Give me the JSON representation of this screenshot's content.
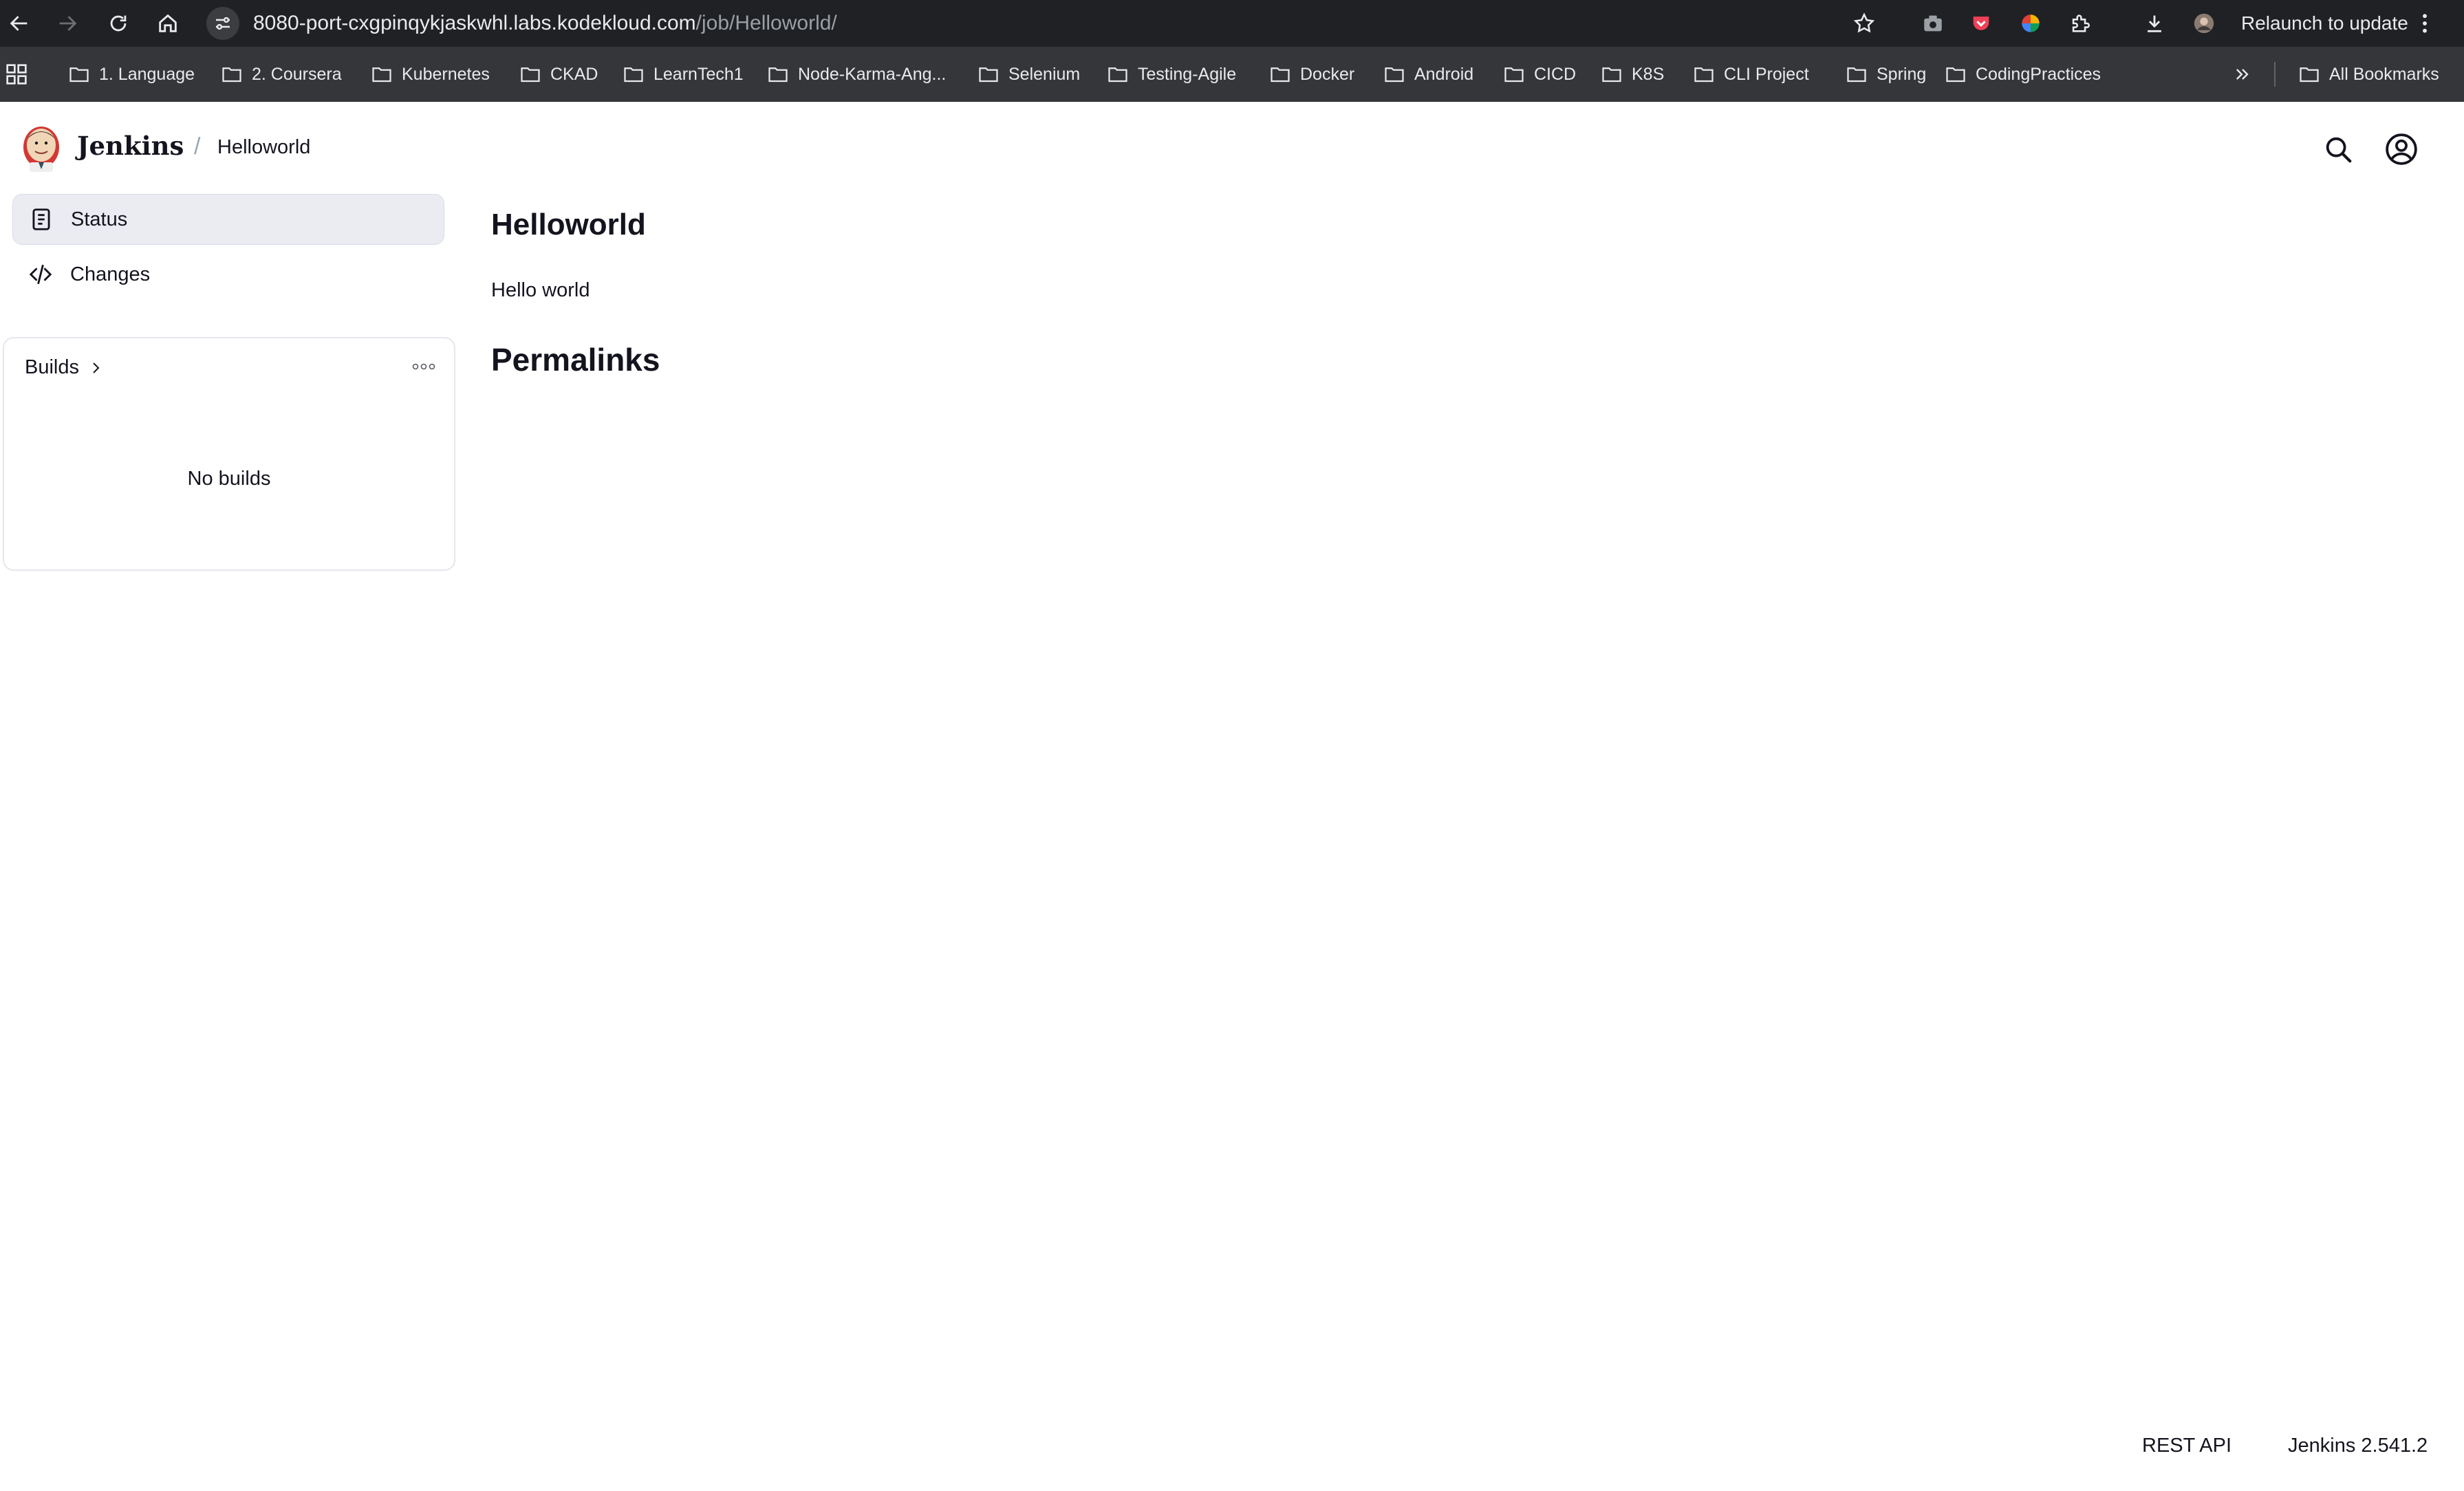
{
  "browser": {
    "url_host": "8080-port-cxgpinqykjaskwhl.labs.kodekloud.com",
    "url_path": "/job/Helloworld/",
    "relaunch_label": "Relaunch to update",
    "bookmarks": [
      "1. Language",
      "2. Coursera",
      "Kubernetes",
      "CKAD",
      "LearnTech1",
      "Node-Karma-Ang...",
      "Selenium",
      "Testing-Agile",
      "Docker",
      "Android",
      "CICD",
      "K8S",
      "CLI Project",
      "Spring",
      "CodingPractices"
    ],
    "all_bookmarks_label": "All Bookmarks"
  },
  "header": {
    "app_name": "Jenkins",
    "breadcrumb": "Helloworld"
  },
  "sidebar": {
    "items": [
      {
        "label": "Status",
        "icon": "document-icon",
        "active": true
      },
      {
        "label": "Changes",
        "icon": "code-icon",
        "active": false
      }
    ]
  },
  "builds": {
    "title": "Builds",
    "empty_text": "No builds"
  },
  "main": {
    "title": "Helloworld",
    "description": "Hello world",
    "permalinks_title": "Permalinks"
  },
  "footer": {
    "rest_api": "REST API",
    "version": "Jenkins 2.541.2"
  },
  "colors": {
    "browser_bar": "#202124",
    "bookmarks_bar": "#35363a",
    "active_side_item": "#eaecf2",
    "text": "#14141f"
  }
}
